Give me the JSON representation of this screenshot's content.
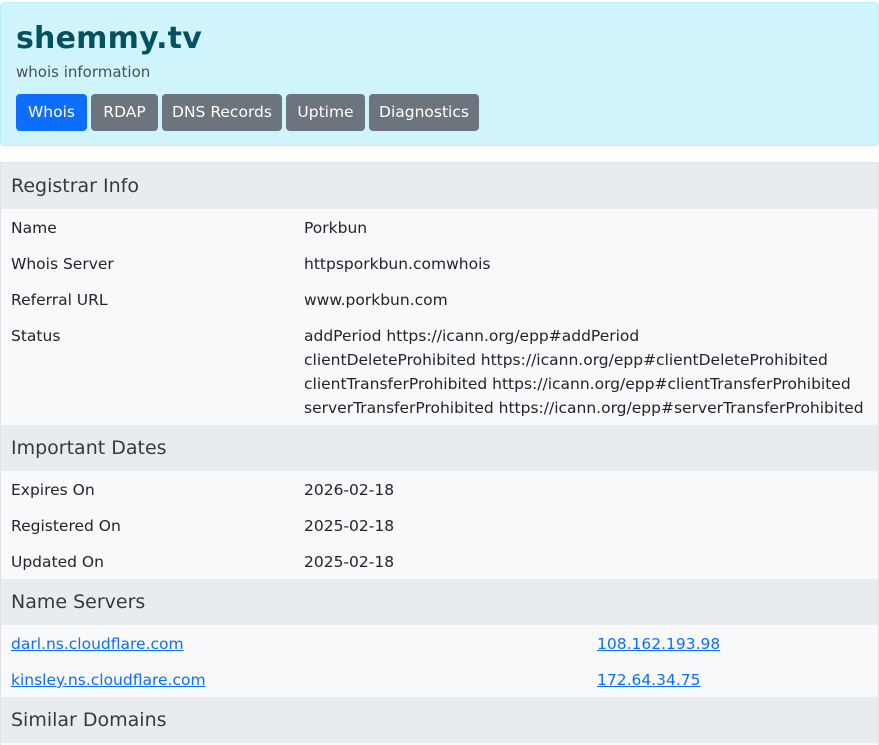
{
  "header": {
    "title": "shemmy.tv",
    "subtitle": "whois information",
    "tabs": [
      {
        "label": "Whois",
        "active": true
      },
      {
        "label": "RDAP",
        "active": false
      },
      {
        "label": "DNS Records",
        "active": false
      },
      {
        "label": "Uptime",
        "active": false
      },
      {
        "label": "Diagnostics",
        "active": false
      }
    ]
  },
  "registrar": {
    "heading": "Registrar Info",
    "name_label": "Name",
    "name_value": "Porkbun",
    "whois_server_label": "Whois Server",
    "whois_server_value": "httpsporkbun.comwhois",
    "referral_label": "Referral URL",
    "referral_value": "www.porkbun.com",
    "status_label": "Status",
    "status_values": [
      "addPeriod https://icann.org/epp#addPeriod",
      "clientDeleteProhibited https://icann.org/epp#clientDeleteProhibited",
      "clientTransferProhibited https://icann.org/epp#clientTransferProhibited",
      "serverTransferProhibited https://icann.org/epp#serverTransferProhibited"
    ]
  },
  "dates": {
    "heading": "Important Dates",
    "expires_label": "Expires On",
    "expires_value": "2026-02-18",
    "registered_label": "Registered On",
    "registered_value": "2025-02-18",
    "updated_label": "Updated On",
    "updated_value": "2025-02-18"
  },
  "nameservers": {
    "heading": "Name Servers",
    "items": [
      {
        "host": "darl.ns.cloudflare.com",
        "ip": "108.162.193.98"
      },
      {
        "host": "kinsley.ns.cloudflare.com",
        "ip": "172.64.34.75"
      }
    ]
  },
  "similar": {
    "heading": "Similar Domains"
  },
  "colors": {
    "header_bg": "#cff4fc",
    "title_color": "#055160",
    "tab_active": "#0d6efd",
    "tab_inactive": "#6c757d",
    "section_head_bg": "#e9ecef",
    "link": "#0d6efd"
  }
}
